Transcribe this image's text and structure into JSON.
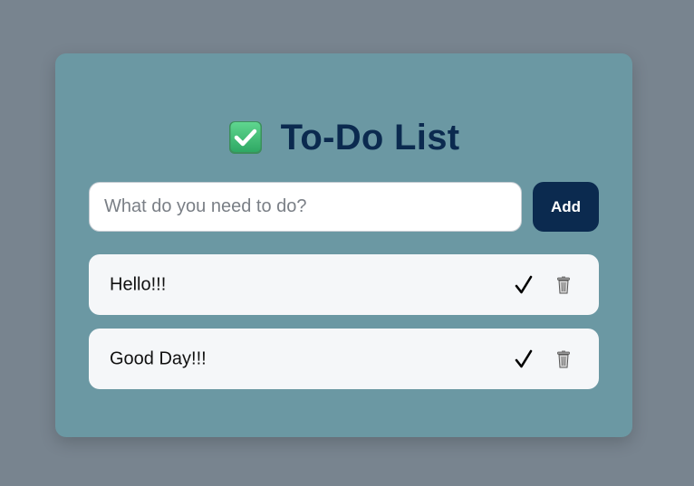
{
  "app": {
    "title": "To-Do List",
    "title_icon": "check-box-icon",
    "accent_color": "#0b2a4f",
    "card_color": "#6b98a3",
    "background_color": "#78848f"
  },
  "input": {
    "value": "",
    "placeholder": "What do you need to do?"
  },
  "add_button": {
    "label": "Add"
  },
  "items": [
    {
      "text": "Hello!!!",
      "done_icon": "checkmark-icon",
      "delete_icon": "trash-icon"
    },
    {
      "text": "Good Day!!!",
      "done_icon": "checkmark-icon",
      "delete_icon": "trash-icon"
    }
  ]
}
